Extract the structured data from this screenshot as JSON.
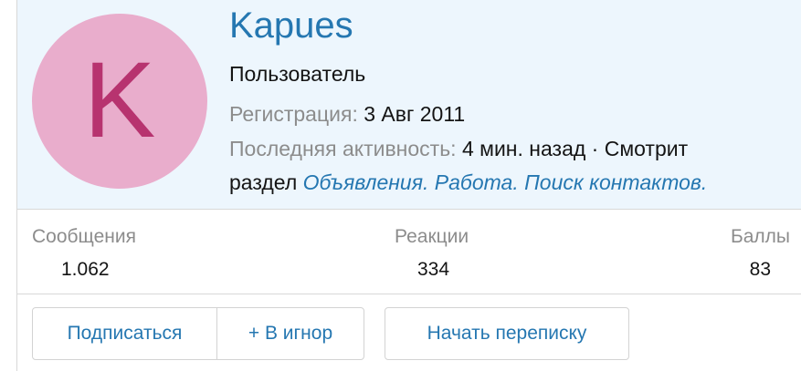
{
  "profile": {
    "avatar_letter": "K",
    "avatar_bg": "#e9adcc",
    "avatar_fg": "#b7336f",
    "username": "Kapues",
    "user_title": "Пользователь",
    "registration_label": "Регистрация:",
    "registration_value": "3 Авг 2011",
    "activity_label": "Последняя активность:",
    "activity_value": "4 мин. назад · Смотрит",
    "activity_prefix": "раздел",
    "activity_link": "Объявления. Работа. Поиск контактов."
  },
  "stats": [
    {
      "label": "Сообщения",
      "value": "1.062"
    },
    {
      "label": "Реакции",
      "value": "334"
    },
    {
      "label": "Баллы",
      "value": "83"
    }
  ],
  "actions": {
    "follow": "Подписаться",
    "ignore": "+ В игнор",
    "message": "Начать переписку"
  },
  "colors": {
    "link": "#2577b1",
    "header_bg": "#edf6fd",
    "muted": "#8c8c8c"
  }
}
